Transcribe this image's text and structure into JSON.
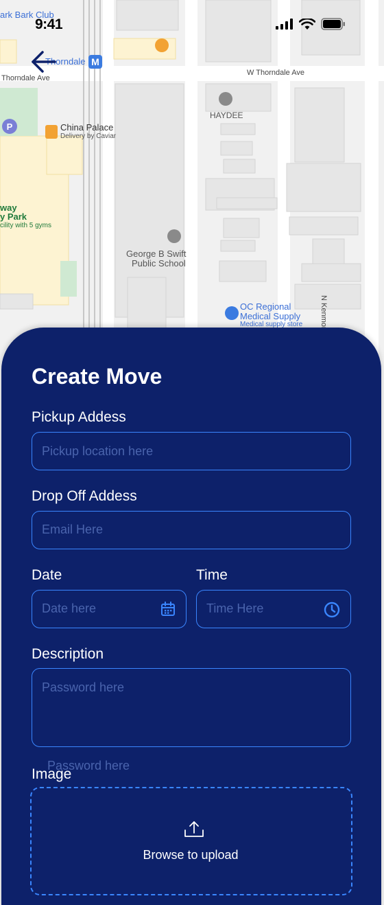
{
  "status_bar": {
    "time": "9:41"
  },
  "map": {
    "labels": {
      "club": "ark Bark Club",
      "thorndale_station": "Thorndale",
      "metro_badge": "M",
      "thorndale_ave": "Thorndale Ave",
      "w_thorndale_ave": "W Thorndale Ave",
      "haydee": "HAYDEE",
      "china_palace": "China Palace",
      "china_palace_sub": "Delivery by Caviar",
      "park_line1": "way",
      "park_line2": "y Park",
      "park_line3": "cility with 5 gyms",
      "school_line1": "George B Swift",
      "school_line2": "Public School",
      "oc_line1": "OC Regional",
      "oc_line2": "Medical Supply",
      "oc_line3": "Medical supply store",
      "kenmore": "N Kenmore Ave"
    }
  },
  "form": {
    "title": "Create Move",
    "pickup": {
      "label": "Pickup Addess",
      "placeholder": "Pickup location here"
    },
    "dropoff": {
      "label": "Drop Off Addess",
      "placeholder": "Email Here"
    },
    "date": {
      "label": "Date",
      "placeholder": "Date here"
    },
    "time": {
      "label": "Time",
      "placeholder": "Time Here"
    },
    "description": {
      "label": "Description",
      "placeholder": "Password here"
    },
    "image": {
      "label": "Image",
      "ghost_placeholder": "Password here",
      "upload_text": "Browse to upload"
    }
  },
  "colors": {
    "sheet_bg": "#0d216a",
    "field_border": "#3a86ff",
    "placeholder": "#4a64ad",
    "text": "#ffffff"
  }
}
